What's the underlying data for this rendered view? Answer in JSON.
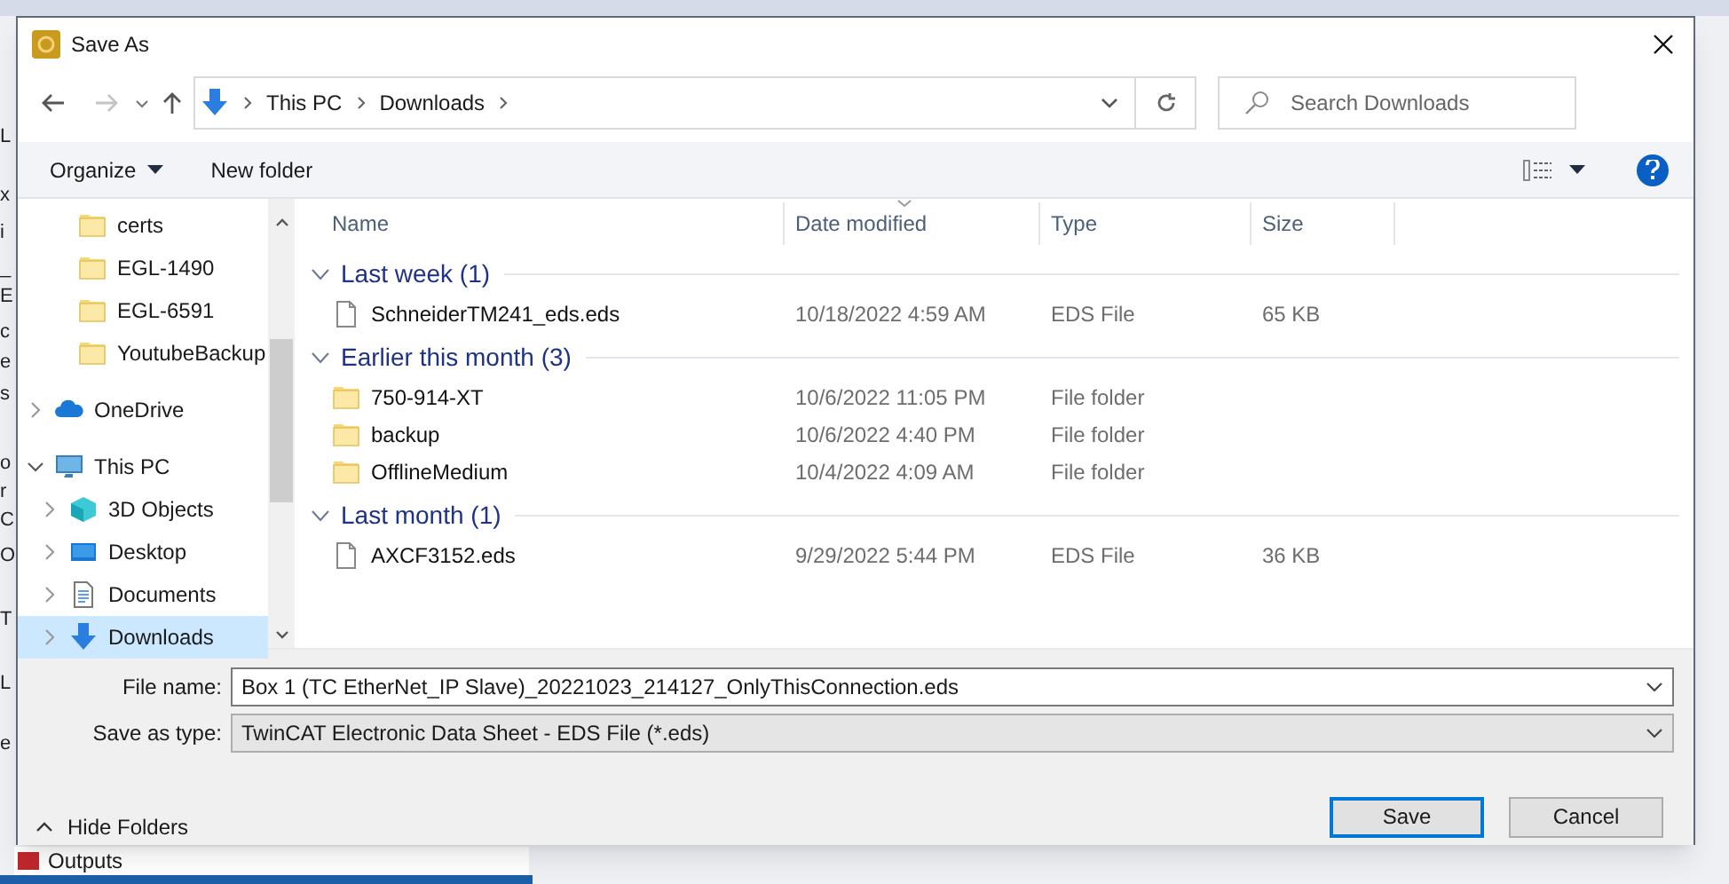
{
  "background_app": {
    "left_fragments": [
      "L",
      "x",
      "i",
      "_",
      "E",
      "c",
      "e",
      "s",
      "o",
      "r",
      "C",
      "O",
      "T",
      "L",
      "e"
    ],
    "bottom_item": "Outputs"
  },
  "window": {
    "title": "Save As"
  },
  "address_bar": {
    "path": [
      "This PC",
      "Downloads"
    ]
  },
  "search": {
    "placeholder": "Search Downloads"
  },
  "toolbar": {
    "organize": "Organize",
    "new_folder": "New folder"
  },
  "nav_pane": {
    "continued_items": [
      {
        "label": "certs",
        "kind": "folder",
        "selected": false
      },
      {
        "label": "EGL-1490",
        "kind": "folder",
        "selected": false
      },
      {
        "label": "EGL-6591",
        "kind": "folder",
        "selected": false
      },
      {
        "label": "YoutubeBackup",
        "kind": "folder",
        "selected": false
      }
    ],
    "items": [
      {
        "label": "OneDrive",
        "kind": "cloud",
        "expanded": false,
        "selected": false
      },
      {
        "label": "This PC",
        "kind": "pc",
        "expanded": true,
        "selected": false,
        "children": [
          {
            "label": "3D Objects",
            "kind": "cube",
            "expanded": false,
            "selected": false
          },
          {
            "label": "Desktop",
            "kind": "desktop",
            "expanded": false,
            "selected": false
          },
          {
            "label": "Documents",
            "kind": "document",
            "expanded": false,
            "selected": false
          },
          {
            "label": "Downloads",
            "kind": "download",
            "expanded": false,
            "selected": true
          }
        ]
      }
    ]
  },
  "file_list": {
    "columns": [
      "Name",
      "Date modified",
      "Type",
      "Size"
    ],
    "groups": [
      {
        "title": "Last week (1)",
        "expanded": true,
        "files": [
          {
            "name": "SchneiderTM241_eds.eds",
            "date": "10/18/2022 4:59 AM",
            "type": "EDS File",
            "size": "65 KB",
            "kind": "file"
          }
        ]
      },
      {
        "title": "Earlier this month (3)",
        "expanded": true,
        "files": [
          {
            "name": "750-914-XT",
            "date": "10/6/2022 11:05 PM",
            "type": "File folder",
            "kind": "folder"
          },
          {
            "name": "backup",
            "date": "10/6/2022 4:40 PM",
            "type": "File folder",
            "kind": "folder"
          },
          {
            "name": "OfflineMedium",
            "date": "10/4/2022 4:09 AM",
            "type": "File folder",
            "kind": "folder"
          }
        ]
      },
      {
        "title": "Last month (1)",
        "expanded": true,
        "files": [
          {
            "name": "AXCF3152.eds",
            "date": "9/29/2022 5:44 PM",
            "type": "EDS File",
            "size": "36 KB",
            "kind": "file"
          }
        ]
      }
    ]
  },
  "file_name": {
    "label": "File name:",
    "value": "Box 1 (TC EtherNet_IP Slave)_20221023_214127_OnlyThisConnection.eds"
  },
  "save_type": {
    "label": "Save as type:",
    "value": "TwinCAT Electronic Data Sheet - EDS File (*.eds)"
  },
  "hide_folders": "Hide Folders",
  "buttons": [
    {
      "label": "Save",
      "default": true
    },
    {
      "label": "Cancel",
      "default": false
    }
  ]
}
